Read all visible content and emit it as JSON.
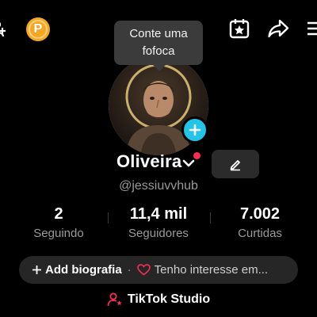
{
  "header": {
    "promote_badge_letter": "P",
    "icons": [
      "add-user-icon",
      "calendar-star-icon",
      "share-icon",
      "menu-icon"
    ]
  },
  "tooltip": {
    "line1": "Conte uma",
    "line2": "fofoca"
  },
  "profile": {
    "display_name": "Oliveira",
    "username": "@jessiuvvhub"
  },
  "stats": {
    "following": {
      "value": "2",
      "label": "Seguindo"
    },
    "followers": {
      "value": "11,4 mil",
      "label": "Seguidores"
    },
    "likes": {
      "value": "7.002",
      "label": "Curtidas"
    }
  },
  "bio": {
    "add_label": "Add biografia",
    "separator": "·",
    "interest_label": "Tenho interesse em..."
  },
  "studio": {
    "label": "TikTok Studio"
  },
  "colors": {
    "background": "#000000",
    "accent_cyan": "#20c5e8",
    "accent_red": "#fe2c55",
    "promote_orange": "#f5a623",
    "muted_text": "#9a9a9a"
  }
}
